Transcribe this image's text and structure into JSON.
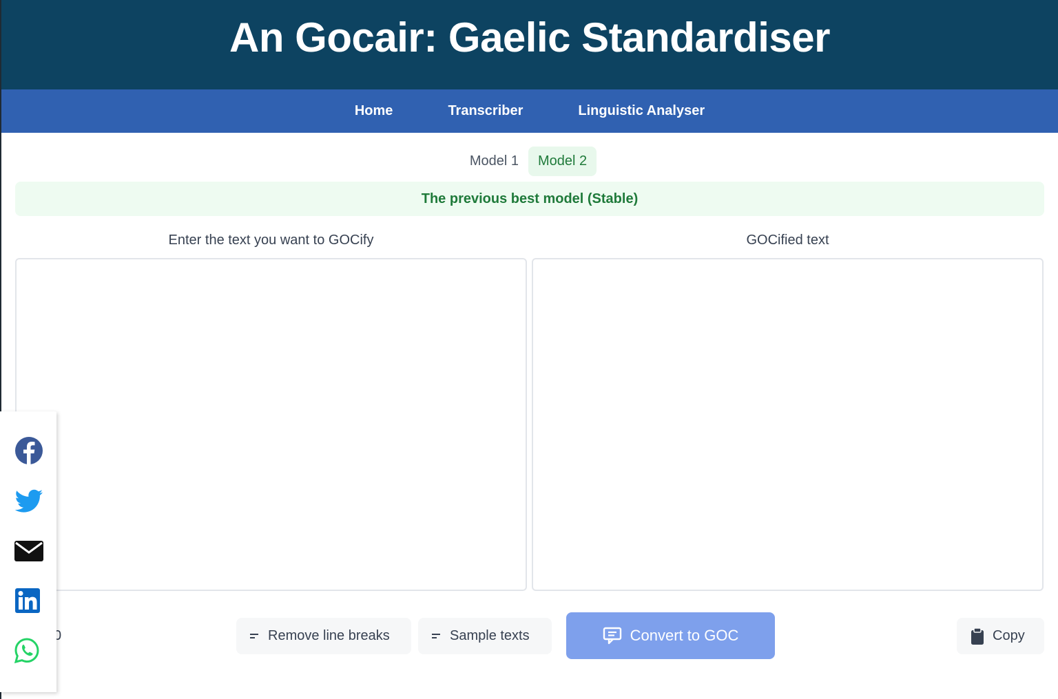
{
  "header": {
    "title": "An Gocair: Gaelic Standardiser"
  },
  "nav": {
    "items": [
      "Home",
      "Transcriber",
      "Linguistic Analyser"
    ]
  },
  "model_tabs": [
    {
      "label": "Model 1",
      "active": false
    },
    {
      "label": "Model 2",
      "active": true
    }
  ],
  "model_banner": "The previous best model (Stable)",
  "input_panel": {
    "label": "Enter the text you want to GOCify",
    "value": ""
  },
  "output_panel": {
    "label": "GOCified text",
    "value": ""
  },
  "counter_partial": "0",
  "buttons": {
    "remove_line_breaks": "Remove line breaks",
    "sample_texts": "Sample texts",
    "convert": "Convert to GOC",
    "copy": "Copy"
  },
  "share": {
    "icons": [
      "facebook-icon",
      "twitter-icon",
      "email-icon",
      "linkedin-icon",
      "whatsapp-icon"
    ]
  },
  "colors": {
    "header_bg": "#0d4361",
    "nav_bg": "#3061b1",
    "active_tab_bg": "#e8f8ec",
    "banner_text": "#1f7a3a",
    "convert_bg": "#7ea0ec"
  }
}
